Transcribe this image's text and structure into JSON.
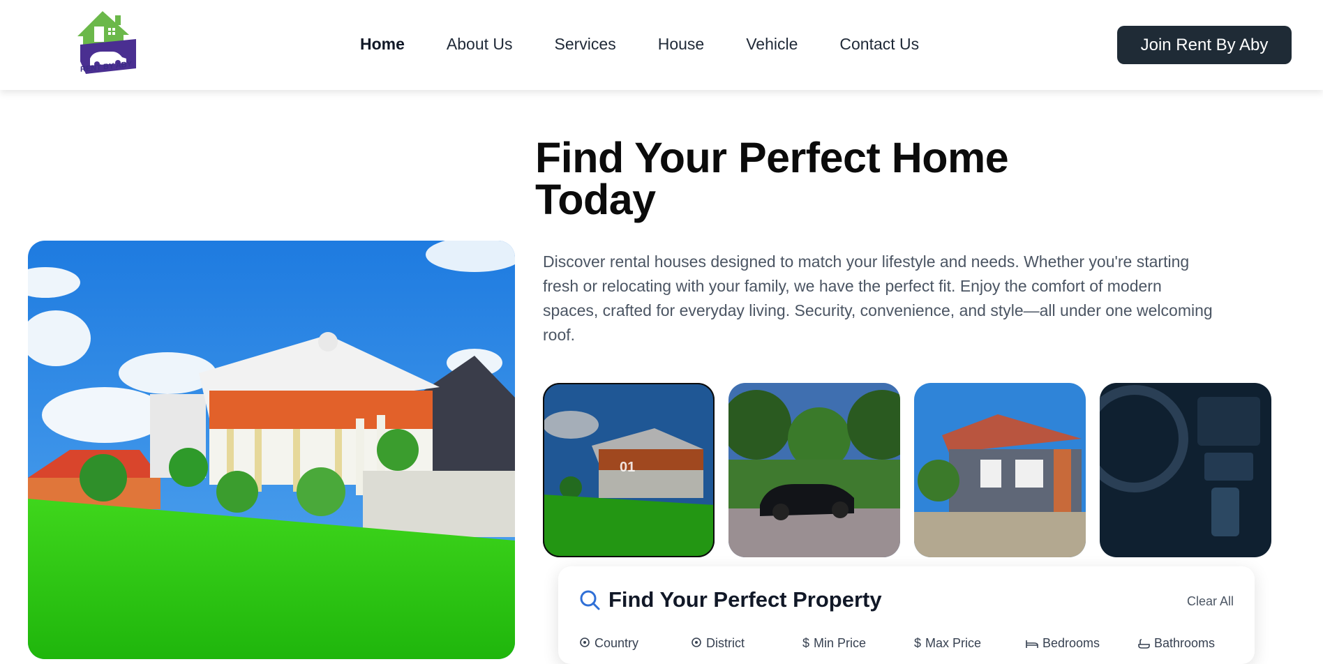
{
  "header": {
    "logo_text": "RENT BY ABY",
    "nav": [
      "Home",
      "About Us",
      "Services",
      "House",
      "Vehicle",
      "Contact Us"
    ],
    "active_nav": "Home",
    "cta_label": "Join Rent By Aby"
  },
  "hero": {
    "title_line1": "Find Your Perfect Home",
    "title_line2": "Today",
    "description": "Discover rental houses designed to match your lifestyle and needs. Whether you're starting fresh or relocating with your family, we have the perfect fit. Enjoy the comfort of modern spaces, crafted for everyday living. Security, convenience, and style—all under one welcoming roof.",
    "active_thumb_label": "01"
  },
  "search": {
    "title": "Find Your Perfect Property",
    "clear_label": "Clear All",
    "filters": [
      {
        "label": "Country",
        "icon": "location-pin-icon"
      },
      {
        "label": "District",
        "icon": "location-pin-icon"
      },
      {
        "label": "Min Price",
        "icon": "dollar-icon"
      },
      {
        "label": "Max Price",
        "icon": "dollar-icon"
      },
      {
        "label": "Bedrooms",
        "icon": "bed-icon"
      },
      {
        "label": "Bathrooms",
        "icon": "bath-icon"
      }
    ]
  },
  "colors": {
    "logo_green": "#6bb84a",
    "logo_purple": "#4a2f91",
    "cta_bg": "#1f2b36",
    "search_icon": "#2f6fd6"
  }
}
